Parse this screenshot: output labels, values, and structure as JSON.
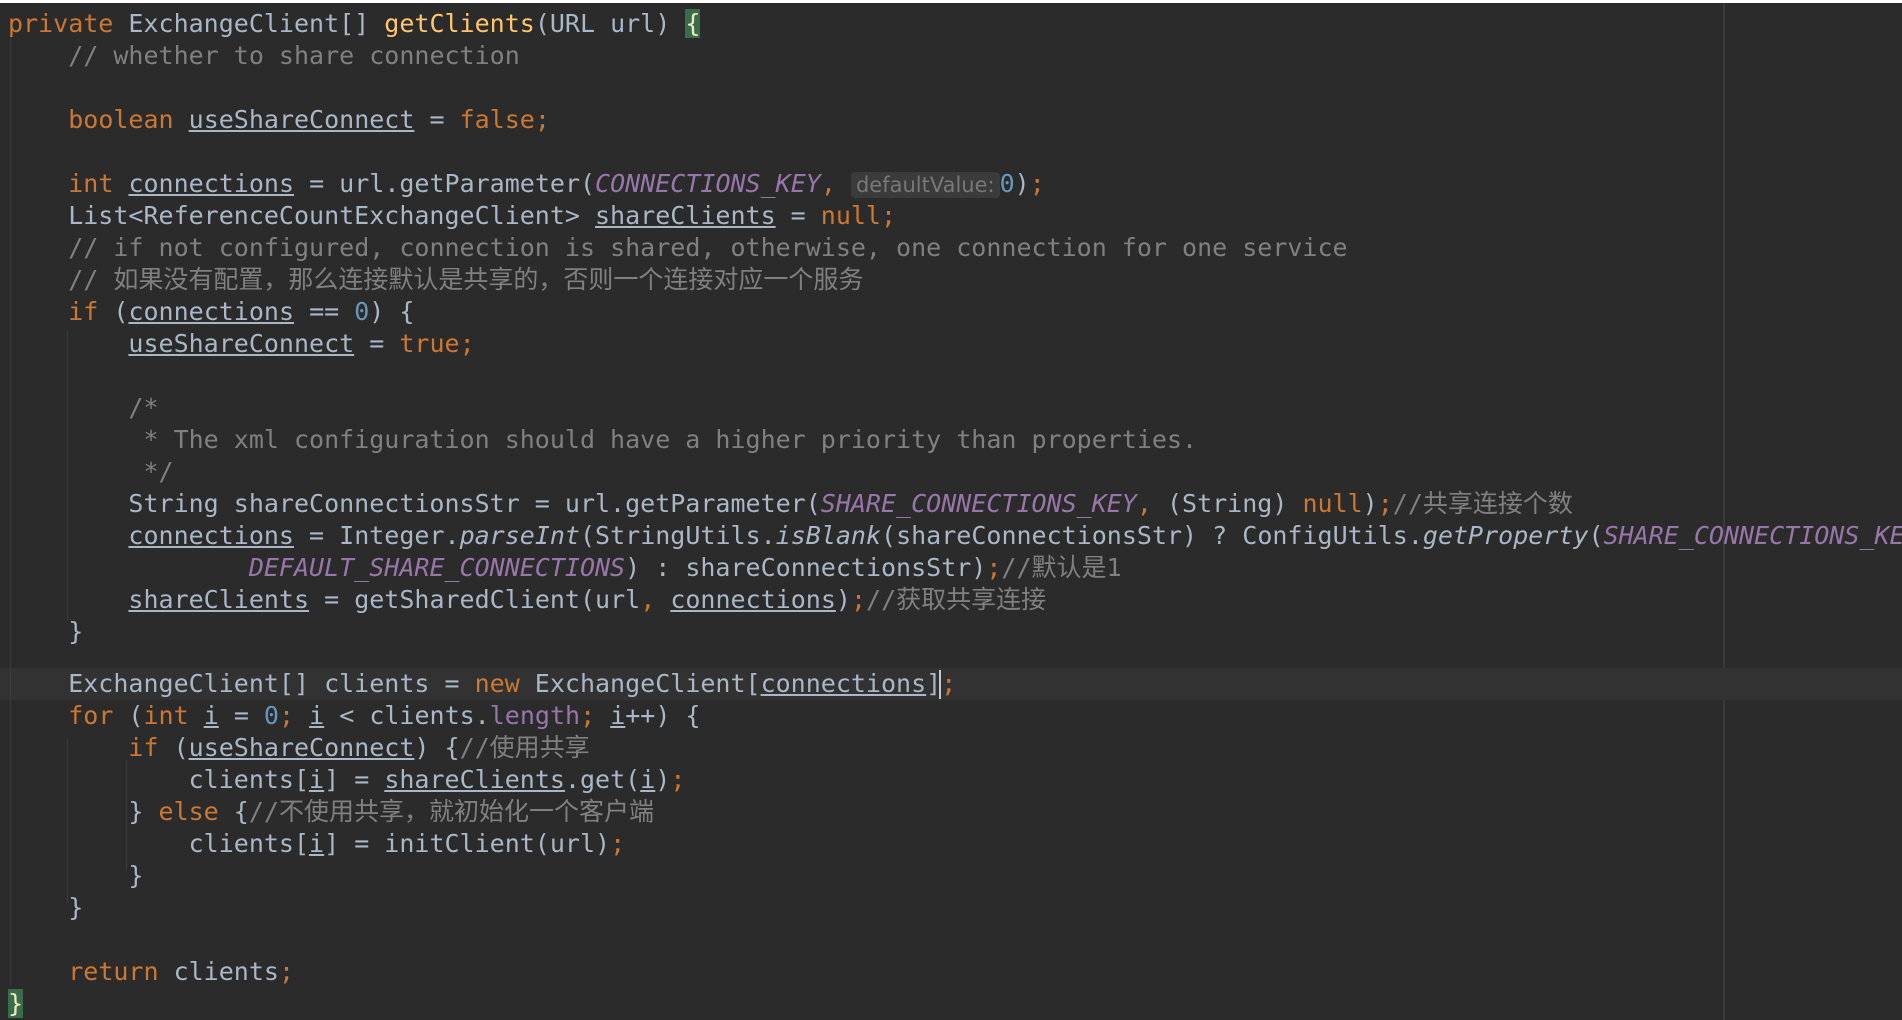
{
  "editor": {
    "language": "Java",
    "lines": [
      "private ExchangeClient[] getClients(URL url) {",
      "    // whether to share connection",
      "",
      "    boolean useShareConnect = false;",
      "",
      "    int connections = url.getParameter(CONNECTIONS_KEY,  defaultValue: 0);",
      "    List<ReferenceCountExchangeClient> shareClients = null;",
      "    // if not configured, connection is shared, otherwise, one connection for one service",
      "    // 如果没有配置，那么连接默认是共享的，否则一个连接对应一个服务",
      "    if (connections == 0) {",
      "        useShareConnect = true;",
      "",
      "        /*",
      "         * The xml configuration should have a higher priority than properties.",
      "         */",
      "        String shareConnectionsStr = url.getParameter(SHARE_CONNECTIONS_KEY, (String) null);//共享连接个数",
      "        connections = Integer.parseInt(StringUtils.isBlank(shareConnectionsStr) ? ConfigUtils.getProperty(SHARE_CONNECTIONS_KEY,",
      "                DEFAULT_SHARE_CONNECTIONS) : shareConnectionsStr);//默认是1",
      "        shareClients = getSharedClient(url, connections);//获取共享连接",
      "    }",
      "",
      "    ExchangeClient[] clients = new ExchangeClient[connections];",
      "    for (int i = 0; i < clients.length; i++) {",
      "        if (useShareConnect) {//使用共享",
      "            clients[i] = shareClients.get(i);",
      "        } else {//不使用共享，就初始化一个客户端",
      "            clients[i] = initClient(url);",
      "        }",
      "    }",
      "",
      "    return clients;",
      "}"
    ],
    "inlay_hint": "defaultValue:",
    "colors": {
      "background": "#2b2b2b",
      "keyword": "#cc7832",
      "method": "#ffc66d",
      "comment": "#808080",
      "constant": "#9876aa",
      "number": "#6897bb",
      "text": "#a9b7c6"
    }
  }
}
